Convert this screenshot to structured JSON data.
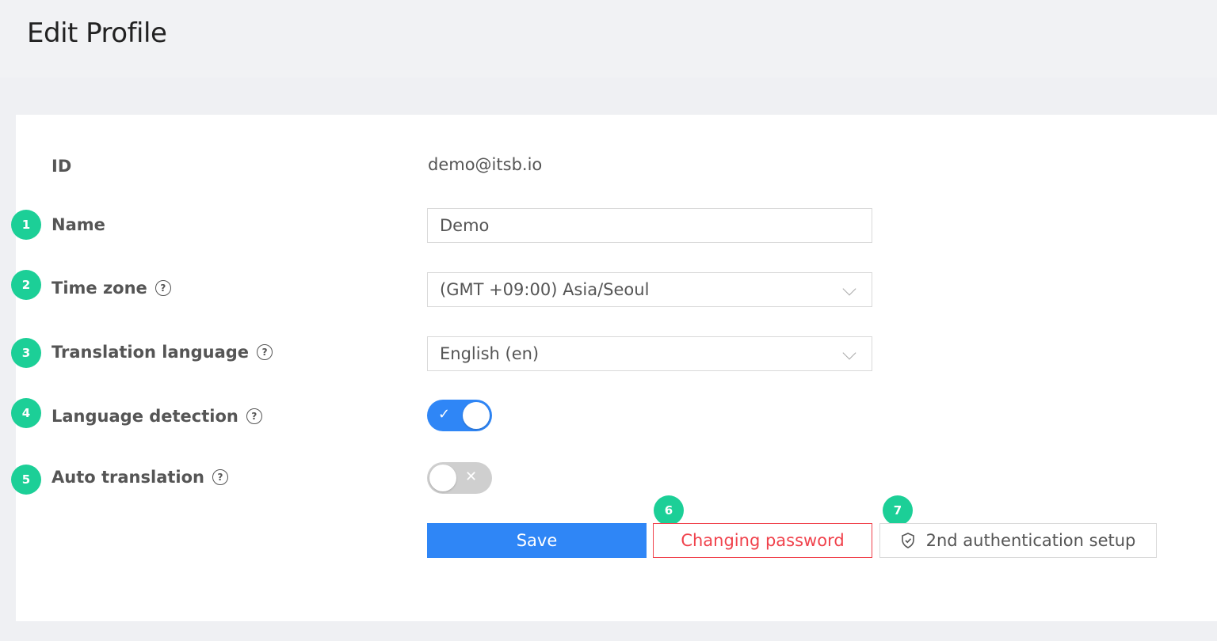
{
  "page": {
    "title": "Edit Profile"
  },
  "form": {
    "id_label": "ID",
    "id_value": "demo@itsb.io",
    "name_label": "Name",
    "name_value": "Demo",
    "timezone_label": "Time zone",
    "timezone_value": "(GMT +09:00) Asia/Seoul",
    "translation_language_label": "Translation language",
    "translation_language_value": "English (en)",
    "language_detection_label": "Language detection",
    "language_detection_on": true,
    "auto_translation_label": "Auto translation",
    "auto_translation_on": false
  },
  "buttons": {
    "save": "Save",
    "change_password": "Changing password",
    "second_auth": "2nd authentication setup"
  },
  "badges": [
    "1",
    "2",
    "3",
    "4",
    "5",
    "6",
    "7"
  ],
  "icons": {
    "help": "question-circle-icon",
    "select": "chevron-down-icon",
    "toggle_on": "check-icon",
    "toggle_off": "x-icon",
    "second_auth": "shield-check-icon"
  },
  "colors": {
    "primary": "#2f86f6",
    "danger": "#f0424c",
    "badge": "#1ccf97"
  }
}
